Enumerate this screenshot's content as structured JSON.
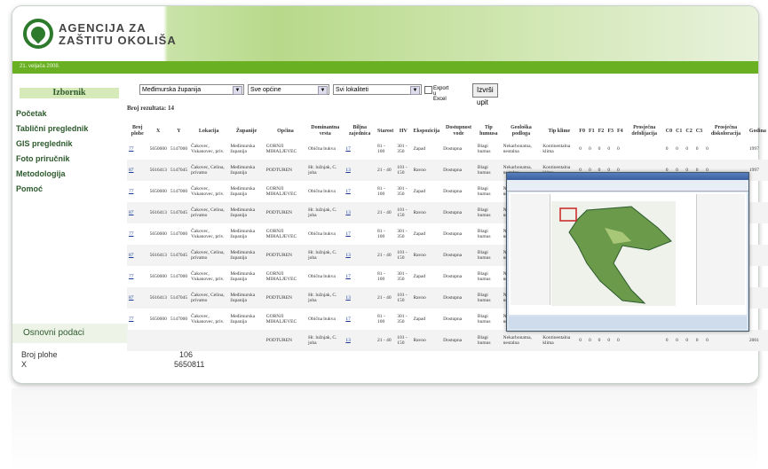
{
  "brand": {
    "line1": "AGENCIJA ZA",
    "line2": "ZAŠTITU OKOLIŠA"
  },
  "greenbar_text": "21. veljača 2008.",
  "sidebar": {
    "title": "Izbornik",
    "items": [
      "Početak",
      "Tablični preglednik",
      "GIS preglednik",
      "Foto priručnik",
      "Metodologija",
      "Pomoć"
    ],
    "basic_title": "Osnovni podaci",
    "basic": [
      {
        "label": "Broj plohe",
        "value": "106"
      },
      {
        "label": "X",
        "value": "5650811"
      }
    ]
  },
  "filters": {
    "county": "Međimurska županija",
    "municipality": "Sve općine",
    "location": "Svi lokaliteti",
    "export_label": "Export u Excel",
    "run_button": "Izvrši upit"
  },
  "result_count": "Broj rezultata: 14",
  "table": {
    "headers": [
      "Broj plohe",
      "X",
      "Y",
      "Lokacija",
      "Županije",
      "Općina",
      "Dominantna vrsta",
      "Biljna zajednica",
      "Starost",
      "HV",
      "Ekspozicija",
      "Dostupnost vode",
      "Tip humusa",
      "Geološka podloga",
      "Tip klime",
      "F0",
      "F1",
      "F2",
      "F3",
      "F4",
      "Prosječna defolijacija",
      "C0",
      "C1",
      "C2",
      "C3",
      "Prosječna diskoloracija",
      "Godina"
    ],
    "rows": [
      [
        "77",
        "5650000",
        "5147000",
        "Čakovec, Vukanovec, priv.",
        "Međimurska županija",
        "GORNJI MIHALJEVEC",
        "Obična bukva",
        "17",
        "81 - 100",
        "301 - 350",
        "Zapad",
        "Dostupna",
        "Blagi humus",
        "Nekarbonatna, nestalna",
        "Kontinentalna klima",
        "0",
        "0",
        "0",
        "0",
        "0",
        "",
        "0",
        "0",
        "0",
        "0",
        "0",
        "1997"
      ],
      [
        "87",
        "5616413",
        "5147045",
        "Čakovec, Celina, privatno",
        "Međimurska županija",
        "PODTUREN",
        "Hr. lužnjak, C. joha",
        "13",
        "21 - 40",
        "101 - 150",
        "Ravno",
        "Dostupna",
        "Blagi humus",
        "Nekarbonatna, nestalna",
        "Kontinentalna klima",
        "0",
        "0",
        "0",
        "0",
        "0",
        "",
        "0",
        "0",
        "0",
        "0",
        "0",
        "1997"
      ],
      [
        "77",
        "5650000",
        "5147000",
        "Čakovec, Vukanovec, priv.",
        "Međimurska županija",
        "GORNJI MIHALJEVEC",
        "Obična bukva",
        "17",
        "81 - 100",
        "301 - 350",
        "Zapad",
        "Dostupna",
        "Blagi humus",
        "Nekarbonatna, nestalna",
        "",
        "",
        "",
        "",
        "",
        "",
        "",
        "",
        "",
        "",
        "",
        "",
        ""
      ],
      [
        "87",
        "5616413",
        "5147045",
        "Čakovec, Celina, privatno",
        "Međimurska županija",
        "PODTUREN",
        "Hr. lužnjak, C. joha",
        "13",
        "21 - 40",
        "101 - 150",
        "Ravno",
        "Dostupna",
        "Blagi humus",
        "Nekarbonatna, nestalna",
        "",
        "",
        "",
        "",
        "",
        "",
        "",
        "",
        "",
        "",
        "",
        "",
        ""
      ],
      [
        "77",
        "5650000",
        "5147000",
        "Čakovec, Vukanovec, priv.",
        "Međimurska županija",
        "GORNJI MIHALJEVEC",
        "Obična bukva",
        "17",
        "81 - 100",
        "301 - 350",
        "Zapad",
        "Dostupna",
        "Blagi humus",
        "Nekarbonatna, nestalna",
        "",
        "",
        "",
        "",
        "",
        "",
        "",
        "",
        "",
        "",
        "",
        "",
        ""
      ],
      [
        "87",
        "5616413",
        "5147045",
        "Čakovec, Celina, privatno",
        "Međimurska županija",
        "PODTUREN",
        "Hr. lužnjak, C. joha",
        "13",
        "21 - 40",
        "101 - 150",
        "Ravno",
        "Dostupna",
        "Blagi humus",
        "Nekarbonatna, nestalna",
        "",
        "",
        "",
        "",
        "",
        "",
        "",
        "",
        "",
        "",
        "",
        "",
        ""
      ],
      [
        "77",
        "5650000",
        "5147000",
        "Čakovec, Vukanovec, priv.",
        "Međimurska županija",
        "GORNJI MIHALJEVEC",
        "Obična bukva",
        "17",
        "81 - 100",
        "301 - 350",
        "Zapad",
        "Dostupna",
        "Blagi humus",
        "Nekarbonatna, nestalna",
        "",
        "",
        "",
        "",
        "",
        "",
        "",
        "",
        "",
        "",
        "",
        "",
        ""
      ],
      [
        "87",
        "5616413",
        "5147045",
        "Čakovec, Celina, privatno",
        "Međimurska županija",
        "PODTUREN",
        "Hr. lužnjak, C. joha",
        "13",
        "21 - 40",
        "101 - 150",
        "Ravno",
        "Dostupna",
        "Blagi humus",
        "Nekarbonatna, nestalna",
        "",
        "",
        "",
        "",
        "",
        "",
        "",
        "",
        "",
        "",
        "",
        "",
        ""
      ],
      [
        "77",
        "5650000",
        "5147000",
        "Čakovec, Vukanovec, priv.",
        "Međimurska županija",
        "GORNJI MIHALJEVEC",
        "Obična bukva",
        "17",
        "81 - 100",
        "301 - 350",
        "Zapad",
        "Dostupna",
        "Blagi humus",
        "Nekarbonatna, nestalna",
        "",
        "",
        "",
        "",
        "",
        "",
        "",
        "",
        "",
        "",
        "",
        "",
        ""
      ],
      [
        "",
        "",
        "",
        "",
        "",
        "PODTUREN",
        "Hr. lužnjak, C. joha",
        "13",
        "21 - 40",
        "101 - 150",
        "Ravno",
        "Dostupna",
        "Blagi humus",
        "Nekarbonatna, nestalna",
        "Kontinentalna klima",
        "0",
        "0",
        "0",
        "0",
        "0",
        "",
        "0",
        "0",
        "0",
        "0",
        "0",
        "2001"
      ]
    ]
  },
  "popup": {
    "title": "Pregled karte"
  },
  "colors": {
    "brand_green": "#6ab023",
    "dark_green": "#2d7a2d"
  }
}
